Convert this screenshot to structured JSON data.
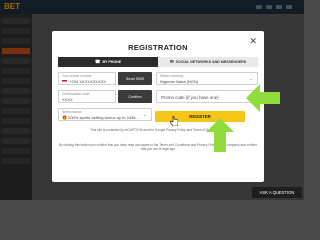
{
  "site": {
    "logo": "BET"
  },
  "modal": {
    "title": "REGISTRATION",
    "close": "✕",
    "tabs": [
      {
        "label": "BY PHONE",
        "icon": "phone-icon",
        "active": true
      },
      {
        "label": "SOCIAL NETWORKS AND MESSENGERS",
        "icon": "chat-icon",
        "active": false
      }
    ],
    "phone": {
      "label": "Your phone number",
      "code": "+234",
      "value": "XXXXXXXXXX",
      "send_button": "Send SMS"
    },
    "currency": {
      "label": "Select currency",
      "value": "Nigerian Naira (NGN)"
    },
    "confirmation": {
      "label": "Confirmation code",
      "value": "XXXX",
      "confirm_button": "Confirm"
    },
    "promo": {
      "placeholder": "Promo code (if you have one)"
    },
    "bonus": {
      "label": "Select bonus",
      "value": "200% sports betting bonus up to 2436..."
    },
    "register_button": "REGISTER",
    "recaptcha_text": "This site is protected by reCAPTCHA and the Google Privacy Policy and Terms of Service apply.",
    "recaptcha_links": [
      "Privacy Policy",
      "Terms of Service"
    ],
    "consent_text": "By clicking this button you confirm that you have read and agree to the Terms and Conditions and Privacy Policy of the company and confirm that you are of legal age",
    "consent_links": [
      "Terms and Conditions",
      "Privacy Policy"
    ]
  },
  "ask_question": "ASK A QUESTION",
  "colors": {
    "accent": "#f5c518",
    "arrow": "#8fdc3c",
    "header": "#1e2b3a",
    "tab_active": "#2b2b2b"
  }
}
